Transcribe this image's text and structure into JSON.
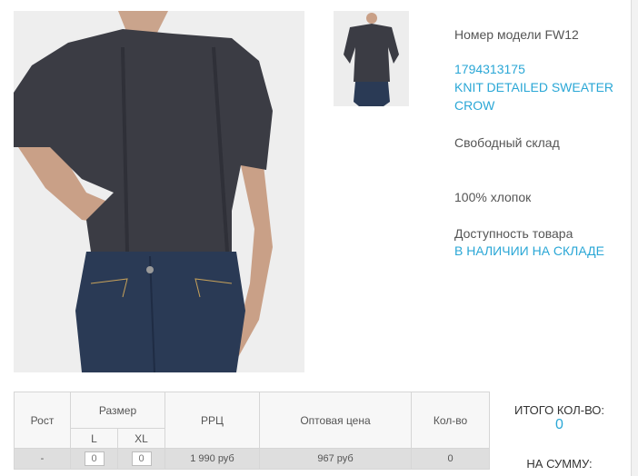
{
  "product": {
    "model_line": "Номер модели FW12",
    "sku": "1794313175",
    "name": "KNIT DETAILED SWEATER CROW",
    "fit": "Свободный склад",
    "material": "100% хлопок",
    "availability_label": "Доступность товара",
    "availability_value": "В НАЛИЧИИ НА СКЛАДЕ"
  },
  "table": {
    "headers": {
      "height": "Рост",
      "size": "Размер",
      "size_l": "L",
      "size_xl": "XL",
      "rrp": "РРЦ",
      "wholesale": "Оптовая цена",
      "qty": "Кол-во"
    },
    "row": {
      "height": "-",
      "qty_l": "0",
      "qty_xl": "0",
      "rrp": "1 990 руб",
      "wholesale": "967 руб",
      "qty": "0"
    }
  },
  "totals": {
    "qty_label": "ИТОГО КОЛ-ВО:",
    "qty_value": "0",
    "sum_label": "НА СУММУ:"
  },
  "colors": {
    "accent": "#2aa7d6",
    "sweater": "#3b3c44",
    "jeans": "#2a3a55"
  }
}
